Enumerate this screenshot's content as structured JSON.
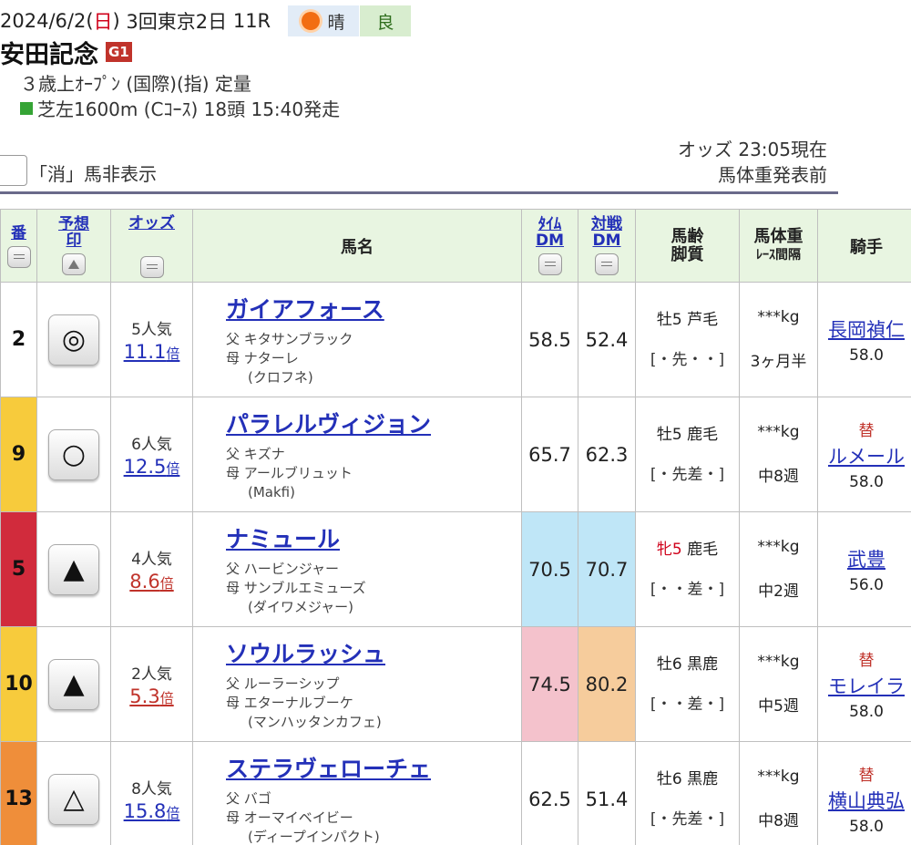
{
  "race": {
    "date": "2024/6/2",
    "dow": "日",
    "meeting": "3回東京2日",
    "race_no": "11R",
    "weather": "晴",
    "ground": "良",
    "name": "安田記念",
    "grade": "G1",
    "conditions": "３歳上ｵｰﾌﾟﾝ (国際)(指) 定量",
    "course": "芝左1600m (Cｺｰｽ) 18頭 15:40発走"
  },
  "status": {
    "odds_time": "オッズ 23:05現在",
    "weight_status": "馬体重発表前",
    "hide_label": "「消」馬非表示"
  },
  "table": {
    "headers": {
      "num": "番",
      "mark": "予想印",
      "odds": "オッズ",
      "horse": "馬名",
      "time_dm": "ﾀｲﾑDM",
      "battle_dm": "対戦DM",
      "age_line1": "馬齢",
      "age_line2": "脚質",
      "weight_line1": "馬体重",
      "weight_line2": "ﾚｰｽ間隔",
      "jockey": "騎手"
    },
    "rows": [
      {
        "num": "2",
        "mark": "◎",
        "popularity": "5人気",
        "odds": "11.1",
        "odds_unit": "倍",
        "odds_color": "blue",
        "horse": "ガイアフォース",
        "sire": "父 キタサンブラック",
        "dam": "母 ナターレ",
        "bms": "(クロフネ)",
        "time_dm": "58.5",
        "battle_dm": "52.4",
        "sex": "牡5",
        "sex_female": false,
        "coat": "芦毛",
        "style": "[・先・・]",
        "weight": "***kg",
        "interval": "3ヶ月半",
        "change": "",
        "jockey": "長岡禎仁",
        "jockey_weight": "58.0",
        "frame_color": "#ffffff",
        "time_bg": "#ffffff",
        "battle_bg": "#ffffff"
      },
      {
        "num": "9",
        "mark": "○",
        "popularity": "6人気",
        "odds": "12.5",
        "odds_unit": "倍",
        "odds_color": "blue",
        "horse": "パラレルヴィジョン",
        "sire": "父 キズナ",
        "dam": "母 アールブリュット",
        "bms": "(Makfi)",
        "time_dm": "65.7",
        "battle_dm": "62.3",
        "sex": "牡5",
        "sex_female": false,
        "coat": "鹿毛",
        "style": "[・先差・]",
        "weight": "***kg",
        "interval": "中8週",
        "change": "替",
        "jockey": "ルメール",
        "jockey_weight": "58.0",
        "frame_color": "#f7cb3c",
        "time_bg": "#ffffff",
        "battle_bg": "#ffffff"
      },
      {
        "num": "5",
        "mark": "▲",
        "popularity": "4人気",
        "odds": "8.6",
        "odds_unit": "倍",
        "odds_color": "red",
        "horse": "ナミュール",
        "sire": "父 ハービンジャー",
        "dam": "母 サンブルエミューズ",
        "bms": "(ダイワメジャー)",
        "time_dm": "70.5",
        "battle_dm": "70.7",
        "sex": "牝5",
        "sex_female": true,
        "coat": "鹿毛",
        "style": "[・・差・]",
        "weight": "***kg",
        "interval": "中2週",
        "change": "",
        "jockey": "武豊",
        "jockey_weight": "56.0",
        "frame_color": "#d12b3c",
        "time_bg": "#bfe6f7",
        "battle_bg": "#bfe6f7"
      },
      {
        "num": "10",
        "mark": "▲",
        "popularity": "2人気",
        "odds": "5.3",
        "odds_unit": "倍",
        "odds_color": "red",
        "horse": "ソウルラッシュ",
        "sire": "父 ルーラーシップ",
        "dam": "母 エターナルブーケ",
        "bms": "(マンハッタンカフェ)",
        "time_dm": "74.5",
        "battle_dm": "80.2",
        "sex": "牡6",
        "sex_female": false,
        "coat": "黒鹿",
        "style": "[・・差・]",
        "weight": "***kg",
        "interval": "中5週",
        "change": "替",
        "jockey": "モレイラ",
        "jockey_weight": "58.0",
        "frame_color": "#f7cb3c",
        "time_bg": "#f4c2cc",
        "battle_bg": "#f6cc9c"
      },
      {
        "num": "13",
        "mark": "△",
        "popularity": "8人気",
        "odds": "15.8",
        "odds_unit": "倍",
        "odds_color": "blue",
        "horse": "ステラヴェローチェ",
        "sire": "父 バゴ",
        "dam": "母 オーマイベイビー",
        "bms": "(ディープインパクト)",
        "time_dm": "62.5",
        "battle_dm": "51.4",
        "sex": "牡6",
        "sex_female": false,
        "coat": "黒鹿",
        "style": "[・先差・]",
        "weight": "***kg",
        "interval": "中8週",
        "change": "替",
        "jockey": "横山典弘",
        "jockey_weight": "58.0",
        "frame_color": "#ef8e3a",
        "time_bg": "#ffffff",
        "battle_bg": "#ffffff"
      }
    ]
  }
}
